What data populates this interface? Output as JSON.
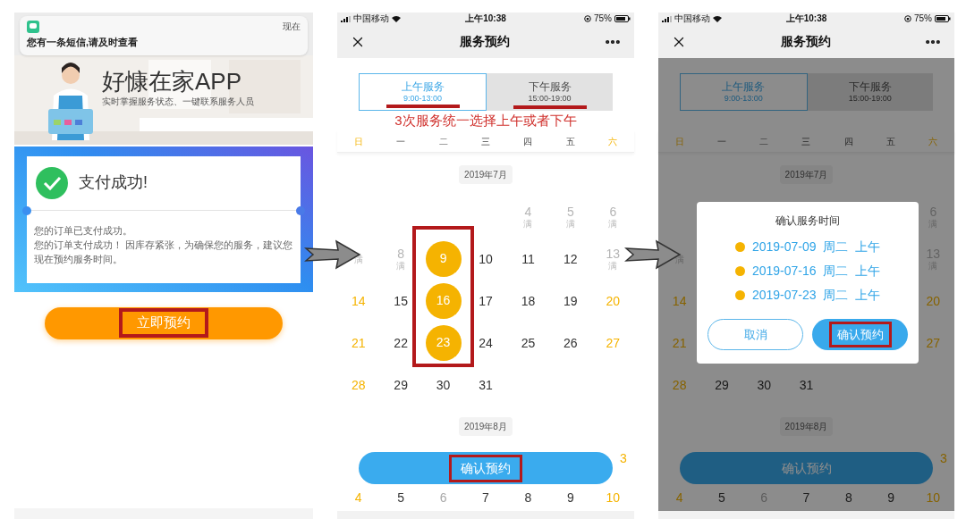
{
  "payment_screen": {
    "notification": {
      "time": "现在",
      "text": "您有一条短信,请及时查看"
    },
    "banner": {
      "title": "好慷在家APP",
      "subtitle": "实时掌握服务状态、一键联系服务人员"
    },
    "result": {
      "title": "支付成功!",
      "lines": [
        "您的订单已支付成功。",
        "您的订单支付成功！ 因库存紧张，为确保您的服务，建议您现在预约服务时间。"
      ]
    },
    "button": "立即预约"
  },
  "booking_screen": {
    "status_bar": {
      "carrier": "中国移动",
      "time": "上午10:38",
      "battery": "75%"
    },
    "title": "服务预约",
    "tabs": [
      {
        "label": "上午服务",
        "hours": "9:00-13:00",
        "selected": true
      },
      {
        "label": "下午服务",
        "hours": "15:00-19:00",
        "selected": false
      }
    ],
    "annotation": "3次服务统一选择上午或者下午",
    "weekdays": [
      {
        "label": "日",
        "weekend": true
      },
      {
        "label": "一",
        "weekend": false
      },
      {
        "label": "二",
        "weekend": false
      },
      {
        "label": "三",
        "weekend": false
      },
      {
        "label": "四",
        "weekend": false
      },
      {
        "label": "五",
        "weekend": false
      },
      {
        "label": "六",
        "weekend": true
      }
    ],
    "months": [
      {
        "label": "2019年7月",
        "weeks": [
          [
            {
              "kind": "empty"
            },
            {
              "kind": "empty"
            },
            {
              "kind": "empty"
            },
            {
              "kind": "empty"
            },
            {
              "day": "4",
              "sub": "满",
              "kind": "full"
            },
            {
              "day": "5",
              "sub": "满",
              "kind": "full"
            },
            {
              "day": "6",
              "sub": "满",
              "kind": "full"
            }
          ],
          [
            {
              "sub": "满",
              "kind": "full"
            },
            {
              "day": "8",
              "sub": "满",
              "kind": "full"
            },
            {
              "day": "9",
              "kind": "selected"
            },
            {
              "day": "10",
              "kind": "normal"
            },
            {
              "day": "11",
              "kind": "normal"
            },
            {
              "day": "12",
              "kind": "normal"
            },
            {
              "day": "13",
              "sub": "满",
              "kind": "full"
            }
          ],
          [
            {
              "day": "14",
              "kind": "weekend"
            },
            {
              "day": "15",
              "kind": "normal"
            },
            {
              "day": "16",
              "kind": "selected"
            },
            {
              "day": "17",
              "kind": "normal"
            },
            {
              "day": "18",
              "kind": "normal"
            },
            {
              "day": "19",
              "kind": "normal"
            },
            {
              "day": "20",
              "kind": "weekend"
            }
          ],
          [
            {
              "day": "21",
              "kind": "weekend"
            },
            {
              "day": "22",
              "kind": "normal"
            },
            {
              "day": "23",
              "kind": "selected"
            },
            {
              "day": "24",
              "kind": "normal"
            },
            {
              "day": "25",
              "kind": "normal"
            },
            {
              "day": "26",
              "kind": "normal"
            },
            {
              "day": "27",
              "kind": "weekend"
            }
          ],
          [
            {
              "day": "28",
              "kind": "weekend"
            },
            {
              "day": "29",
              "kind": "normal"
            },
            {
              "day": "30",
              "kind": "normal"
            },
            {
              "day": "31",
              "kind": "normal"
            },
            {
              "kind": "empty"
            },
            {
              "kind": "empty"
            },
            {
              "kind": "empty"
            }
          ]
        ]
      },
      {
        "label": "2019年8月",
        "weeks": [
          [
            {
              "day": "3",
              "kind": "weekend"
            }
          ],
          [
            {
              "day": "4",
              "kind": "weekend"
            },
            {
              "day": "5",
              "kind": "normal"
            },
            {
              "day": "6",
              "kind": "disabled"
            },
            {
              "day": "7",
              "kind": "normal"
            },
            {
              "day": "8",
              "kind": "normal"
            },
            {
              "day": "9",
              "kind": "normal"
            },
            {
              "day": "10",
              "kind": "weekend"
            }
          ]
        ]
      }
    ],
    "button": "确认预约"
  },
  "confirm_screen": {
    "status_bar": {
      "carrier": "中国移动",
      "time": "上午10:38",
      "battery": "75%"
    },
    "title": "服务预约",
    "tabs": [
      {
        "label": "上午服务",
        "hours": "9:00-13:00",
        "selected": true
      },
      {
        "label": "下午服务",
        "hours": "15:00-19:00",
        "selected": false
      }
    ],
    "weekdays": [
      {
        "label": "日",
        "weekend": true
      },
      {
        "label": "一",
        "weekend": false
      },
      {
        "label": "二",
        "weekend": false
      },
      {
        "label": "三",
        "weekend": false
      },
      {
        "label": "四",
        "weekend": false
      },
      {
        "label": "五",
        "weekend": false
      },
      {
        "label": "六",
        "weekend": true
      }
    ],
    "months": [
      {
        "label": "2019年7月",
        "weeks": [
          [
            {
              "kind": "empty"
            },
            {
              "kind": "empty"
            },
            {
              "kind": "empty"
            },
            {
              "kind": "empty"
            },
            {
              "kind": "empty"
            },
            {
              "kind": "empty"
            },
            {
              "day": "6",
              "sub": "满",
              "kind": "full"
            }
          ],
          [
            {
              "sub": "满",
              "kind": "full"
            },
            {
              "kind": "empty"
            },
            {
              "kind": "empty"
            },
            {
              "kind": "empty"
            },
            {
              "kind": "empty"
            },
            {
              "kind": "empty"
            },
            {
              "day": "13",
              "sub": "满",
              "kind": "full"
            }
          ],
          [
            {
              "day": "14",
              "kind": "weekend"
            },
            {
              "kind": "empty"
            },
            {
              "kind": "empty"
            },
            {
              "kind": "empty"
            },
            {
              "kind": "empty"
            },
            {
              "kind": "empty"
            },
            {
              "day": "20",
              "kind": "weekend"
            }
          ],
          [
            {
              "day": "21",
              "kind": "weekend"
            },
            {
              "kind": "empty"
            },
            {
              "kind": "empty"
            },
            {
              "kind": "empty"
            },
            {
              "kind": "empty"
            },
            {
              "kind": "empty"
            },
            {
              "day": "27",
              "kind": "weekend"
            }
          ],
          [
            {
              "day": "28",
              "kind": "weekend"
            },
            {
              "day": "29",
              "kind": "normal"
            },
            {
              "day": "30",
              "kind": "normal"
            },
            {
              "day": "31",
              "kind": "normal"
            },
            {
              "kind": "empty"
            },
            {
              "kind": "empty"
            },
            {
              "kind": "empty"
            }
          ]
        ]
      },
      {
        "label": "2019年8月",
        "weeks": [
          [
            {
              "day": "3",
              "kind": "weekend"
            }
          ],
          [
            {
              "day": "4",
              "kind": "weekend"
            },
            {
              "day": "5",
              "kind": "normal"
            },
            {
              "day": "6",
              "kind": "disabled"
            },
            {
              "day": "7",
              "kind": "normal"
            },
            {
              "day": "8",
              "kind": "normal"
            },
            {
              "day": "9",
              "kind": "normal"
            },
            {
              "day": "10",
              "kind": "weekend"
            }
          ]
        ]
      }
    ],
    "button": "确认预约",
    "dialog": {
      "title": "确认服务时间",
      "items": [
        {
          "date": "2019-07-09",
          "weekday": "周二",
          "period": "上午"
        },
        {
          "date": "2019-07-16",
          "weekday": "周二",
          "period": "上午"
        },
        {
          "date": "2019-07-23",
          "weekday": "周二",
          "period": "上午"
        }
      ],
      "cancel": "取消",
      "confirm": "确认预约"
    }
  }
}
